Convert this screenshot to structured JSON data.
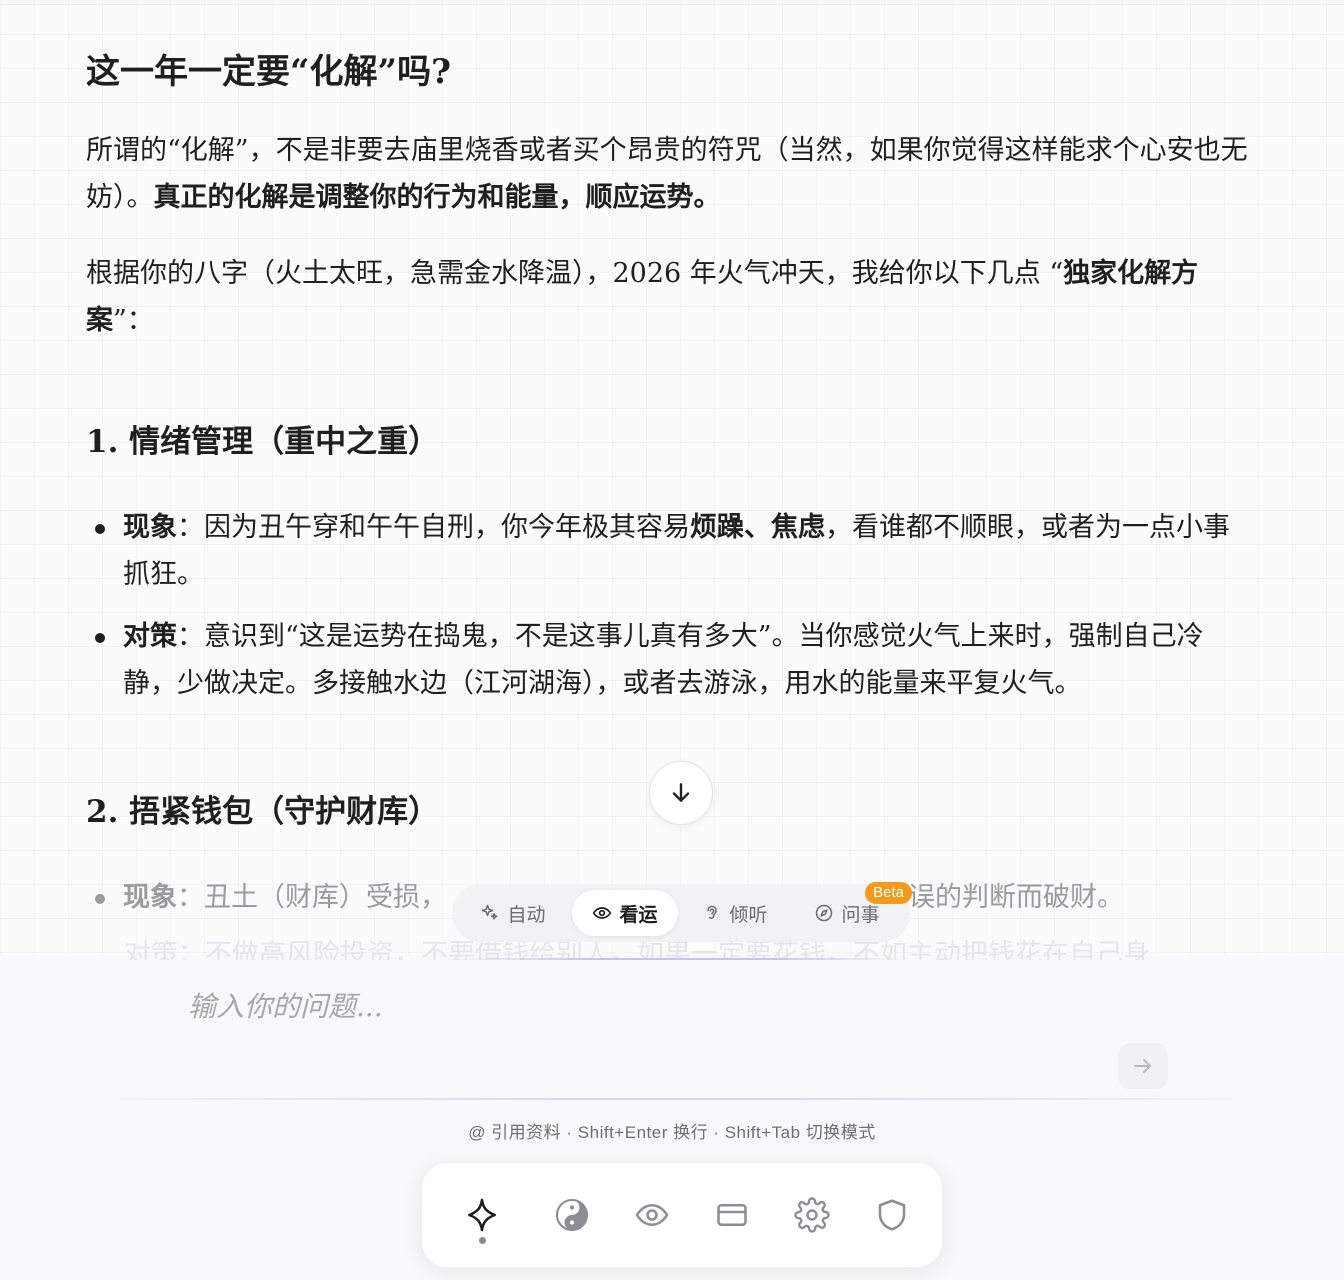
{
  "article": {
    "title": "这一年一定要“化解”吗?",
    "p1_a": "所谓的“化解”，不是非要去庙里烧香或者买个昂贵的符咒（当然，如果你觉得这样能求个心安也无妨）。",
    "p1_b": "真正的化解是调整你的行为和能量，顺应运势。",
    "p2_a": "根据你的八字（火土太旺，急需金水降温），2026 年火气冲天，我给你以下几点 “",
    "p2_b": "独家化解方案",
    "p2_c": "”：",
    "section1": {
      "heading": "1. 情绪管理（重中之重）",
      "b1_label": "现象",
      "b1_a": "：因为丑午穿和午午自刑，你今年极其容易",
      "b1_strong": "烦躁、焦虑",
      "b1_b": "，看谁都不顺眼，或者为一点小事抓狂。",
      "b2_label": "对策",
      "b2_text": "：意识到“这是运势在捣鬼，不是这事儿真有多大”。当你感觉火气上来时，强制自己冷静，少做决定。多接触水边（江河湖海），或者去游泳，用水的能量来平复火气。"
    },
    "section2": {
      "heading": "2. 捂紧钱包（守护财库）",
      "b1_label": "现象",
      "b1_left": "：丑土（财库）受损，",
      "b1_right": "误的判断而破财。",
      "b2_ghost": "对策：不做高风险投资，不要借钱给别人。如果一定要花钱，不如主动把钱花在自己身"
    }
  },
  "modes": [
    {
      "label": "自动",
      "icon": "sparkle-icon",
      "active": false
    },
    {
      "label": "看运",
      "icon": "eye-icon",
      "active": true
    },
    {
      "label": "倾听",
      "icon": "ear-icon",
      "active": false
    },
    {
      "label": "问事",
      "icon": "compass-icon",
      "active": false,
      "badge": "Beta"
    }
  ],
  "composer": {
    "placeholder": "输入你的问题...",
    "hint": "@ 引用资料 · Shift+Enter 换行 · Shift+Tab 切换模式"
  },
  "dock": {
    "items": [
      "sparkle-icon",
      "yin-yang-icon",
      "eye-icon",
      "card-icon",
      "gear-icon",
      "shield-icon"
    ],
    "active_index": 0
  }
}
